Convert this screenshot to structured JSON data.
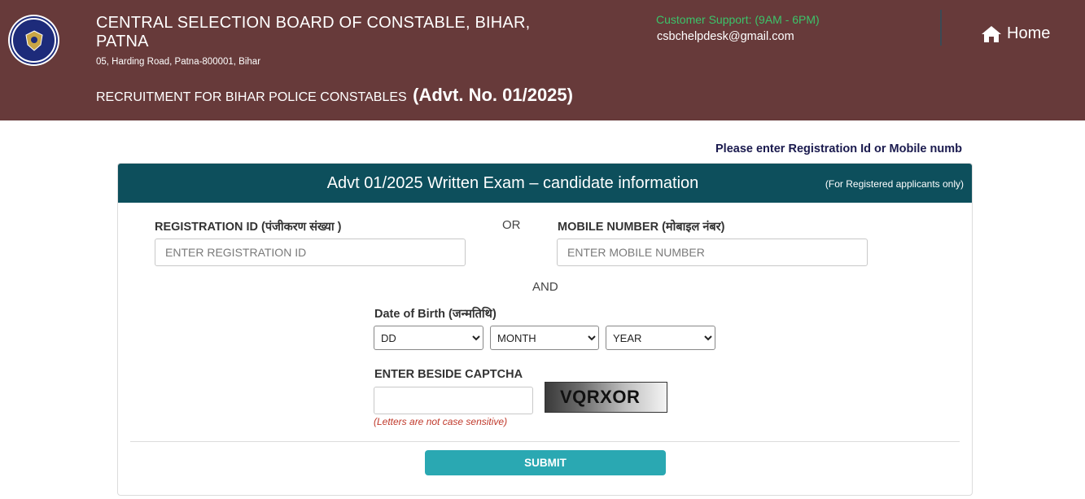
{
  "header": {
    "org_name": "CENTRAL SELECTION BOARD OF CONSTABLE, BIHAR, PATNA",
    "address": "05, Harding Road, Patna-800001, Bihar",
    "recruitment_text": "RECRUITMENT FOR BIHAR POLICE CONSTABLES",
    "advt_text": "(Advt. No. 01/2025)",
    "support_label": "Customer Support: (9AM - 6PM)",
    "support_email": "csbchelpdesk@gmail.com",
    "home_label": "Home",
    "home_icon": "home-icon",
    "logo_icon": "emblem-logo"
  },
  "notice": "Please enter Registration Id or Mobile numb",
  "form": {
    "title": "Advt 01/2025 Written Exam – candidate information",
    "note": "(For Registered applicants only)",
    "registration_label": "REGISTRATION ID (पंजीकरण संख्या )",
    "registration_placeholder": "ENTER REGISTRATION ID",
    "registration_value": "",
    "or_label": "OR",
    "mobile_label": "MOBILE NUMBER (मोबाइल नंबर)",
    "mobile_placeholder": "ENTER MOBILE NUMBER",
    "mobile_value": "",
    "and_label": "AND",
    "dob_label": "Date of Birth (जन्मतिथि)",
    "dob_day": "DD",
    "dob_month": "MONTH",
    "dob_year": "YEAR",
    "captcha_label": "ENTER BESIDE CAPTCHA",
    "captcha_value": "",
    "captcha_text": "VQRXOR",
    "captcha_hint": "(Letters are not case sensitive)",
    "submit_label": "SUBMIT"
  },
  "colors": {
    "header_bg": "#673a3a",
    "card_head_bg": "#0d4f5c",
    "support_green": "#3cc36a",
    "submit_bg": "#2aa8b2",
    "hint_red": "#c0392b"
  }
}
